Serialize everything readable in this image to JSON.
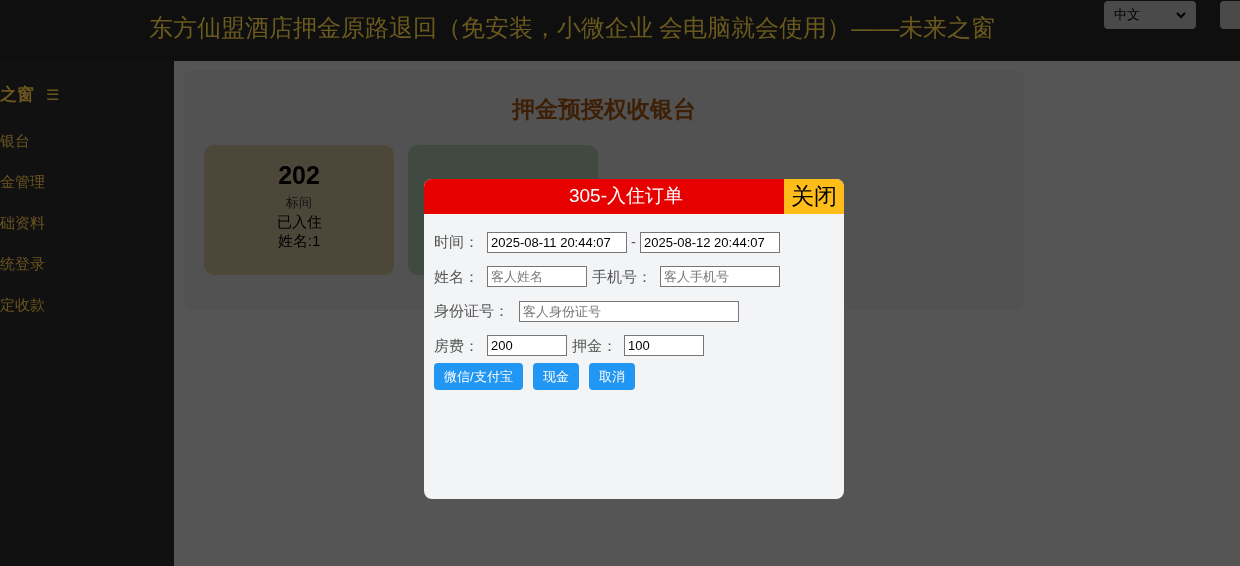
{
  "header": {
    "title": "东方仙盟酒店押金原路退回（免安装，小微企业 会电脑就会使用）——未来之窗",
    "language_select": "中文"
  },
  "sidebar": {
    "logo": "之窗",
    "menu_icon": "☰",
    "items": [
      {
        "label": "银台"
      },
      {
        "label": "金管理"
      },
      {
        "label": "础资料"
      },
      {
        "label": "统登录"
      },
      {
        "label": "定收款"
      }
    ]
  },
  "main": {
    "title": "押金预授权收银台",
    "rooms": [
      {
        "number": "202",
        "type": "标间",
        "status": "已入住",
        "guest": "姓名:1",
        "color": "#4d473a"
      },
      {
        "color": "#404a40"
      }
    ]
  },
  "dialog": {
    "title": "305-入住订单",
    "close": "关闭",
    "time_label": "时间：",
    "start": "2025-08-11 20:44:07",
    "separator": "-",
    "end": "2025-08-12 20:44:07",
    "name_label": "姓名：",
    "name_placeholder": "客人姓名",
    "phone_label": "手机号：",
    "phone_placeholder": "客人手机号",
    "id_label": "身份证号：",
    "id_placeholder": "客人身份证号",
    "fee_label": "房费：",
    "fee": "200",
    "deposit_label": "押金：",
    "deposit": "100",
    "buttons": [
      "微信/支付宝",
      "现金",
      "取消"
    ]
  }
}
